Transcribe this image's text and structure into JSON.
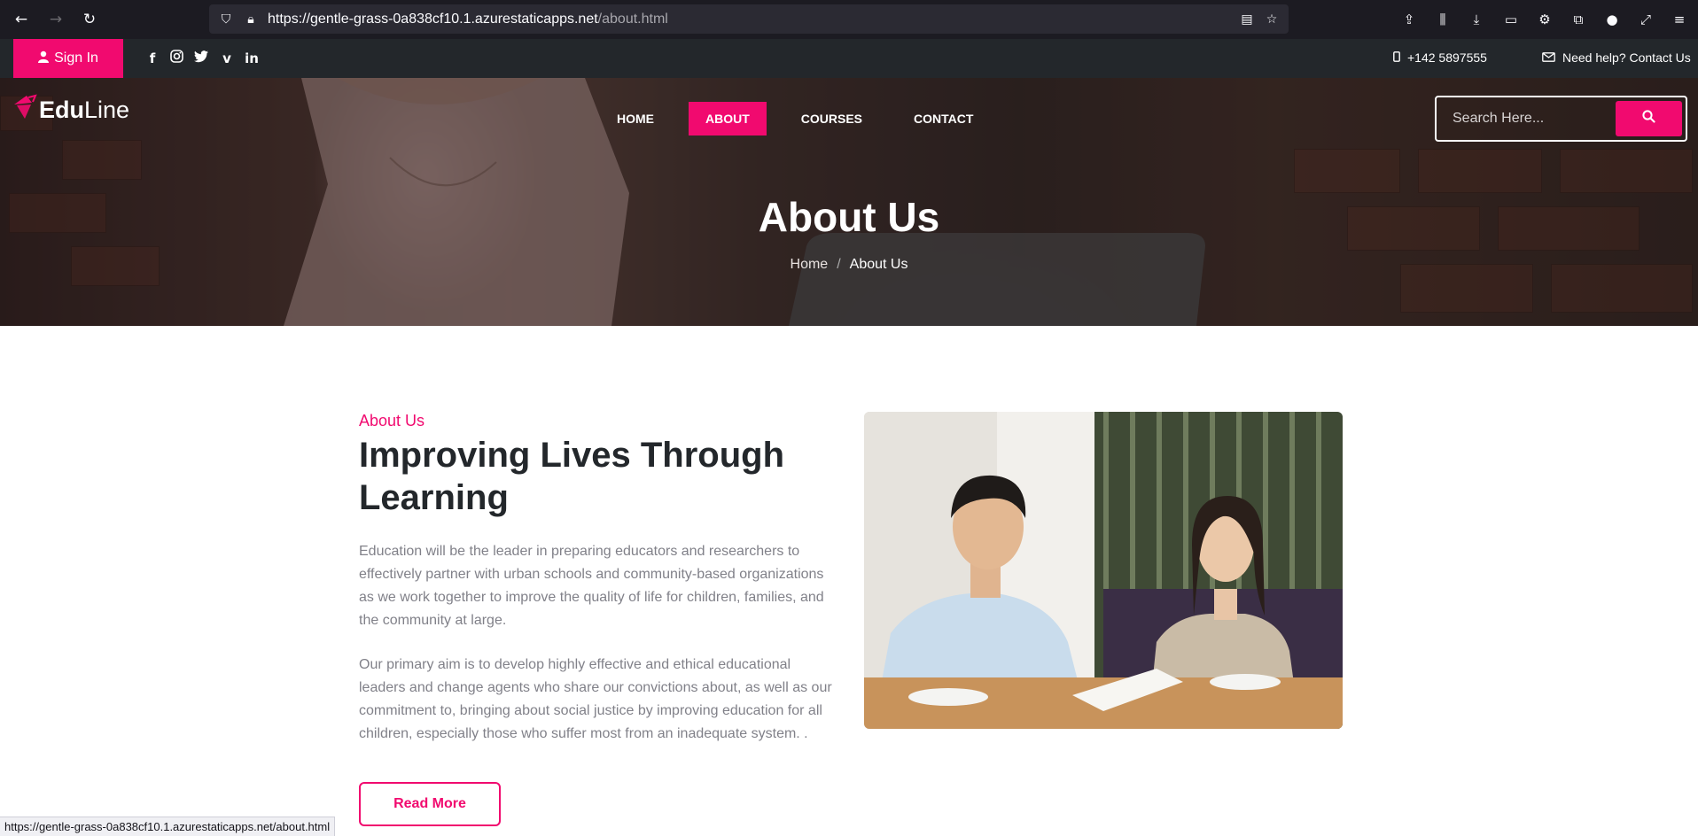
{
  "browser": {
    "url_host": "https://gentle-grass-0a838cf10.1.azurestaticapps.net",
    "url_path": "/about.html",
    "status_url": "https://gentle-grass-0a838cf10.1.azurestaticapps.net/about.html"
  },
  "topbar": {
    "signin_label": "Sign In",
    "phone": "+142 5897555",
    "help": "Need help? Contact Us",
    "social": [
      "facebook",
      "instagram",
      "twitter",
      "vimeo",
      "linkedin"
    ]
  },
  "header": {
    "logo_bold": "Edu",
    "logo_light": "Line",
    "menu": [
      {
        "label": "HOME",
        "active": false
      },
      {
        "label": "ABOUT",
        "active": true
      },
      {
        "label": "COURSES",
        "active": false
      },
      {
        "label": "CONTACT",
        "active": false
      }
    ],
    "search_placeholder": "Search Here..."
  },
  "hero": {
    "title": "About Us",
    "breadcrumb_home": "Home",
    "breadcrumb_sep": "/",
    "breadcrumb_current": "About Us"
  },
  "about": {
    "kicker": "About Us",
    "title": "Improving Lives Through Learning",
    "para1": "Education will be the leader in preparing educators and researchers to effectively partner with urban schools and community-based organizations as we work together to improve the quality of life for children, families, and the community at large.",
    "para2": "Our primary aim is to develop highly effective and ethical educational leaders and change agents who share our convictions about, as well as our commitment to, bringing about social justice by improving education for all children, especially those who suffer most from an inadequate system. .",
    "read_more": "Read More"
  },
  "colors": {
    "accent": "#f10a6f",
    "dark": "#23272b",
    "text_muted": "#818189"
  }
}
